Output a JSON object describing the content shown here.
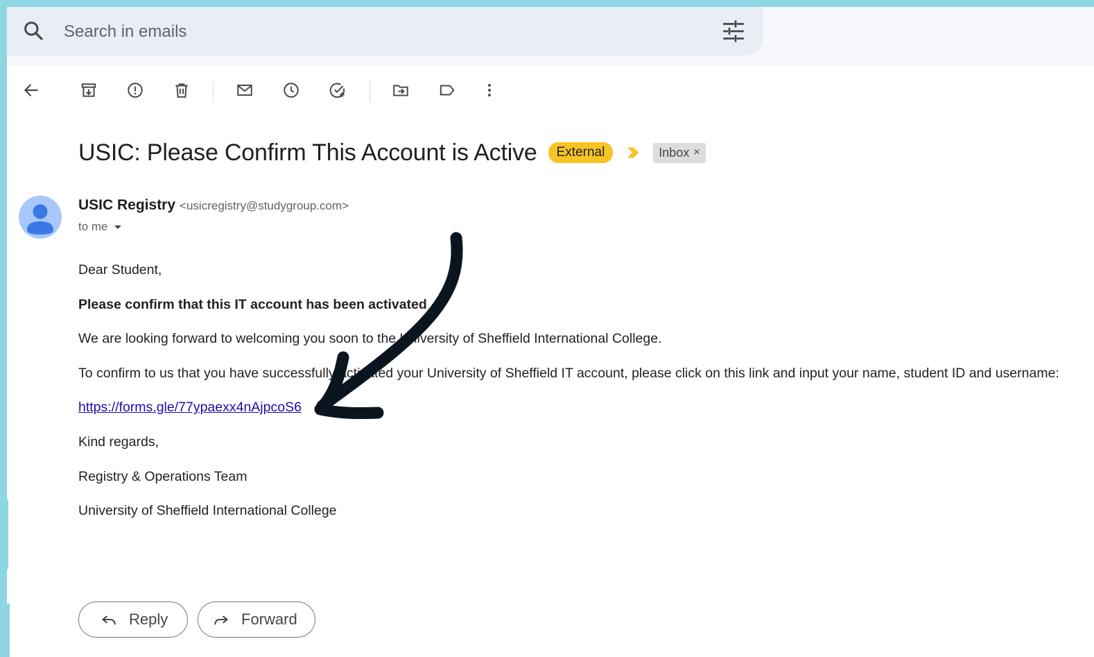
{
  "search": {
    "placeholder": "Search in emails",
    "icon": "search-icon",
    "filter_icon": "tune-icon"
  },
  "toolbar": {
    "buttons": [
      {
        "name": "back",
        "icon": "arrow-left-icon"
      },
      {
        "name": "archive",
        "icon": "archive-icon"
      },
      {
        "name": "report-spam",
        "icon": "report-icon"
      },
      {
        "name": "delete",
        "icon": "trash-icon"
      },
      {
        "name": "mark-unread",
        "icon": "mail-icon"
      },
      {
        "name": "snooze",
        "icon": "clock-icon"
      },
      {
        "name": "add-task",
        "icon": "add-task-icon"
      },
      {
        "name": "move-to",
        "icon": "folder-move-icon"
      },
      {
        "name": "labels",
        "icon": "label-icon"
      },
      {
        "name": "more",
        "icon": "more-vert-icon"
      }
    ]
  },
  "email": {
    "subject": "USIC: Please Confirm This Account is Active",
    "external_badge": "External",
    "inbox_chip": "Inbox",
    "chip_close": "×",
    "sender_name": "USIC Registry",
    "sender_email": "<usicregistry@studygroup.com>",
    "to": "to me",
    "body": {
      "greeting": "Dear Student,",
      "bold_line": "Please confirm that this IT account has been activated",
      "line1": "We are looking forward to welcoming you soon to the University of Sheffield International College.",
      "line2": "To confirm to us that you have successfully activated your University of Sheffield IT account, please click on this link and input your name, student ID and username:",
      "link": "https://forms.gle/77ypaexx4nAjpcoS6",
      "closing": "Kind regards,",
      "signature1": "Registry & Operations Team",
      "signature2": "University of Sheffield International College"
    }
  },
  "actions": {
    "reply": "Reply",
    "forward": "Forward"
  },
  "colors": {
    "frame_border": "#8fd6e3",
    "badge_external": "#f7c325",
    "importance_marker": "#f7c325",
    "link": "#1a0dab",
    "arrow": "#0b1520"
  }
}
